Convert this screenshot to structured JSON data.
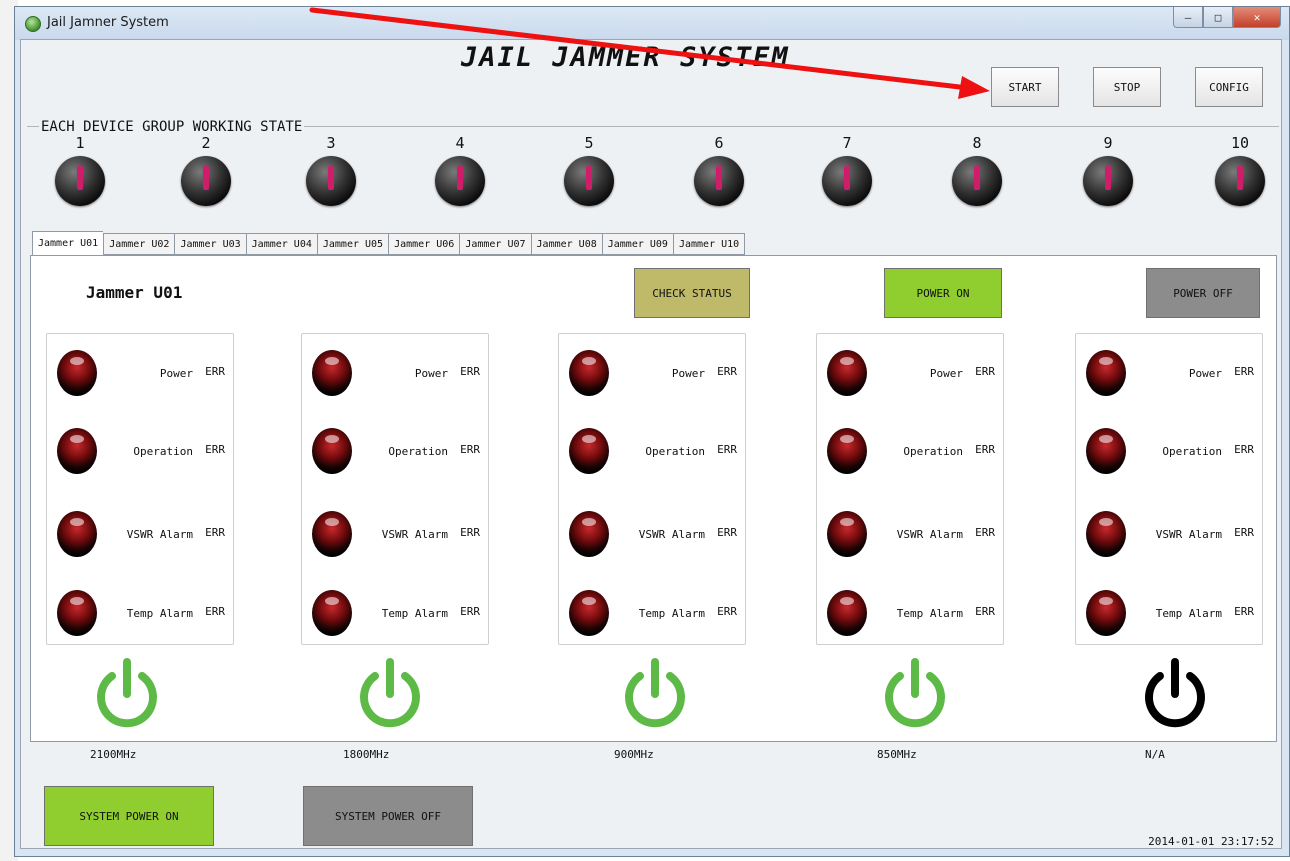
{
  "window": {
    "title": "Jail Jamner System"
  },
  "header": {
    "title": "JAIL JAMMER SYSTEM"
  },
  "toolbar": {
    "start": "START",
    "stop": "STOP",
    "config": "CONFIG"
  },
  "groups": {
    "title": "EACH DEVICE GROUP WORKING STATE",
    "numbers": [
      "1",
      "2",
      "3",
      "4",
      "5",
      "6",
      "7",
      "8",
      "9",
      "10"
    ]
  },
  "tabs": [
    "Jammer U01",
    "Jammer U02",
    "Jammer U03",
    "Jammer U04",
    "Jammer U05",
    "Jammer U06",
    "Jammer U07",
    "Jammer U08",
    "Jammer U09",
    "Jammer U10"
  ],
  "active_tab": "Jammer U01",
  "panel": {
    "title": "Jammer U01",
    "check_status": "CHECK STATUS",
    "power_on": "POWER ON",
    "power_off": "POWER OFF"
  },
  "status_labels": [
    "Power",
    "Operation",
    "VSWR Alarm",
    "Temp Alarm"
  ],
  "status_value": "ERR",
  "modules": [
    {
      "freq": "2100MHz",
      "power_state": "on"
    },
    {
      "freq": "1800MHz",
      "power_state": "on"
    },
    {
      "freq": "900MHz",
      "power_state": "on"
    },
    {
      "freq": "850MHz",
      "power_state": "on"
    },
    {
      "freq": "N/A",
      "power_state": "off"
    }
  ],
  "footer": {
    "system_power_on": "SYSTEM POWER ON",
    "system_power_off": "SYSTEM POWER OFF",
    "timestamp": "2014-01-01 23:17:52"
  },
  "colors": {
    "power_on_green": "#5dba47",
    "power_off_black": "#000000",
    "check_status_bg": "#bfb96a",
    "power_on_bg": "#8fce2e",
    "power_off_bg": "#8c8c8c",
    "group_led_mark": "#cf1d6c",
    "annotation_arrow": "#ee1111"
  }
}
